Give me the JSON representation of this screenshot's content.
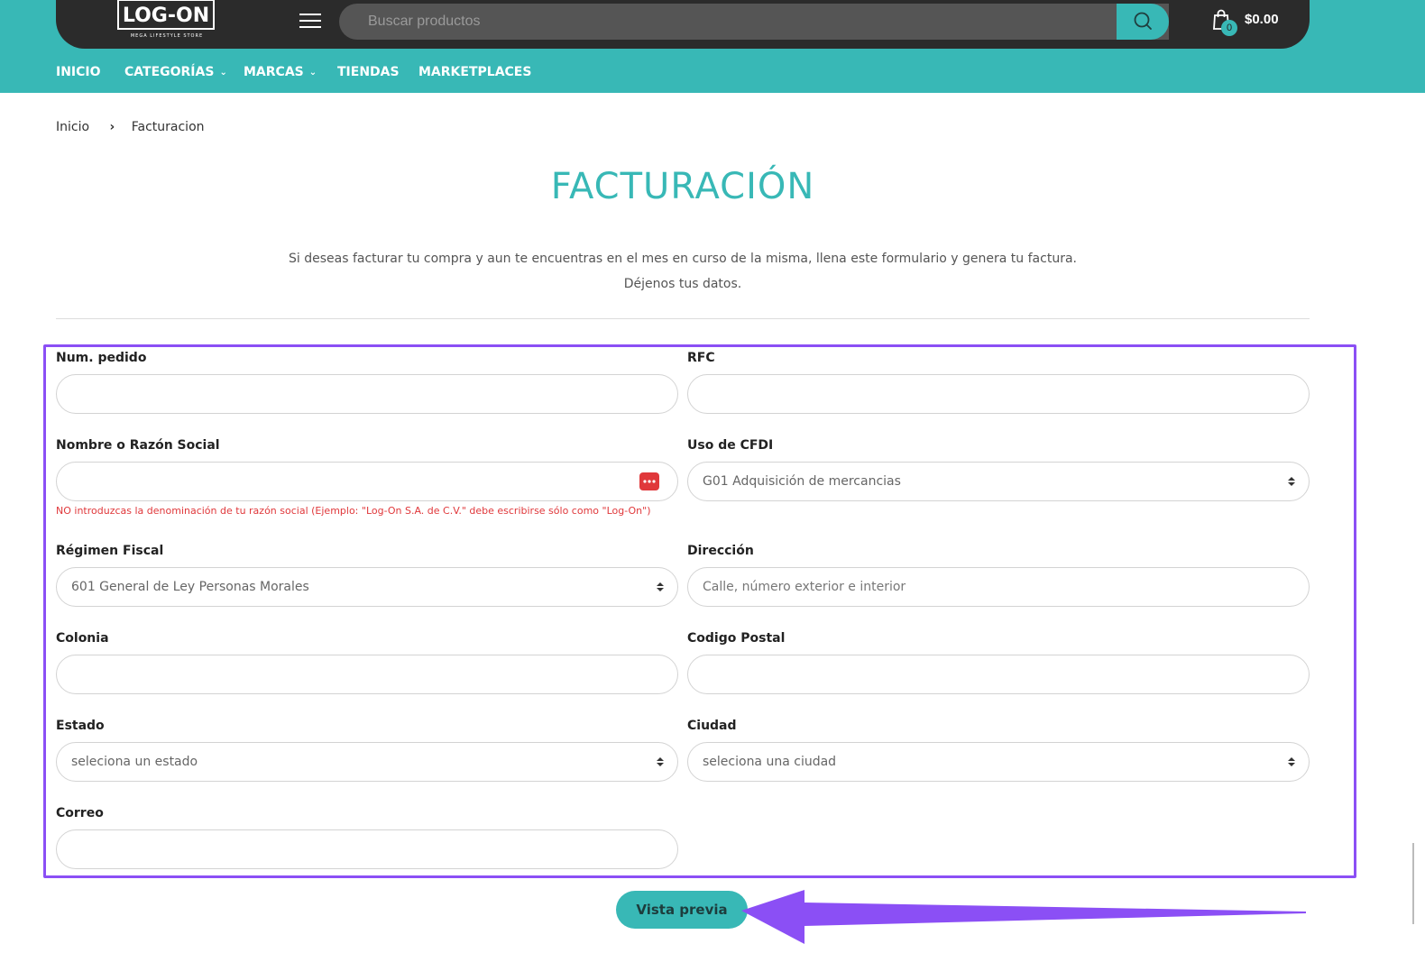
{
  "header": {
    "logo_text": "LOG-ON",
    "logo_tagline": "MEGA LIFESTYLE STORE",
    "search_placeholder": "Buscar productos",
    "cart_count": "0",
    "cart_total": "$0.00"
  },
  "nav": {
    "items": [
      {
        "label": "INICIO"
      },
      {
        "label": "CATEGORÍAS"
      },
      {
        "label": "MARCAS"
      },
      {
        "label": "TIENDAS"
      },
      {
        "label": "MARKETPLACES"
      }
    ]
  },
  "breadcrumb": {
    "home": "Inicio",
    "current": "Facturacion"
  },
  "page": {
    "title": "FACTURACIÓN",
    "intro_line1": "Si deseas facturar tu compra y aun te encuentras en el mes en curso de la misma, llena este formulario y genera tu factura.",
    "intro_line2": "Déjenos tus datos."
  },
  "form": {
    "num_pedido": {
      "label": "Num. pedido",
      "value": ""
    },
    "rfc": {
      "label": "RFC",
      "value": ""
    },
    "razon_social": {
      "label": "Nombre o Razón Social",
      "value": "",
      "help": "NO introduzcas la denominación de tu razón social (Ejemplo: \"Log-On S.A. de C.V.\" debe escribirse sólo como \"Log-On\")"
    },
    "uso_cfdi": {
      "label": "Uso de CFDI",
      "selected": "G01 Adquisición de mercancias"
    },
    "regimen_fiscal": {
      "label": "Régimen Fiscal",
      "selected": "601 General de Ley Personas Morales"
    },
    "direccion": {
      "label": "Dirección",
      "placeholder": "Calle, número exterior e interior"
    },
    "colonia": {
      "label": "Colonia",
      "value": ""
    },
    "codigo_postal": {
      "label": "Codigo Postal",
      "value": ""
    },
    "estado": {
      "label": "Estado",
      "selected": "seleciona un estado"
    },
    "ciudad": {
      "label": "Ciudad",
      "selected": "seleciona una ciudad"
    },
    "correo": {
      "label": "Correo",
      "value": ""
    },
    "submit_label": "Vista previa"
  },
  "colors": {
    "accent": "#38b8b6",
    "header_dark": "#2b2b2b",
    "annotation": "#8b4ff5",
    "error": "#e0383b"
  }
}
